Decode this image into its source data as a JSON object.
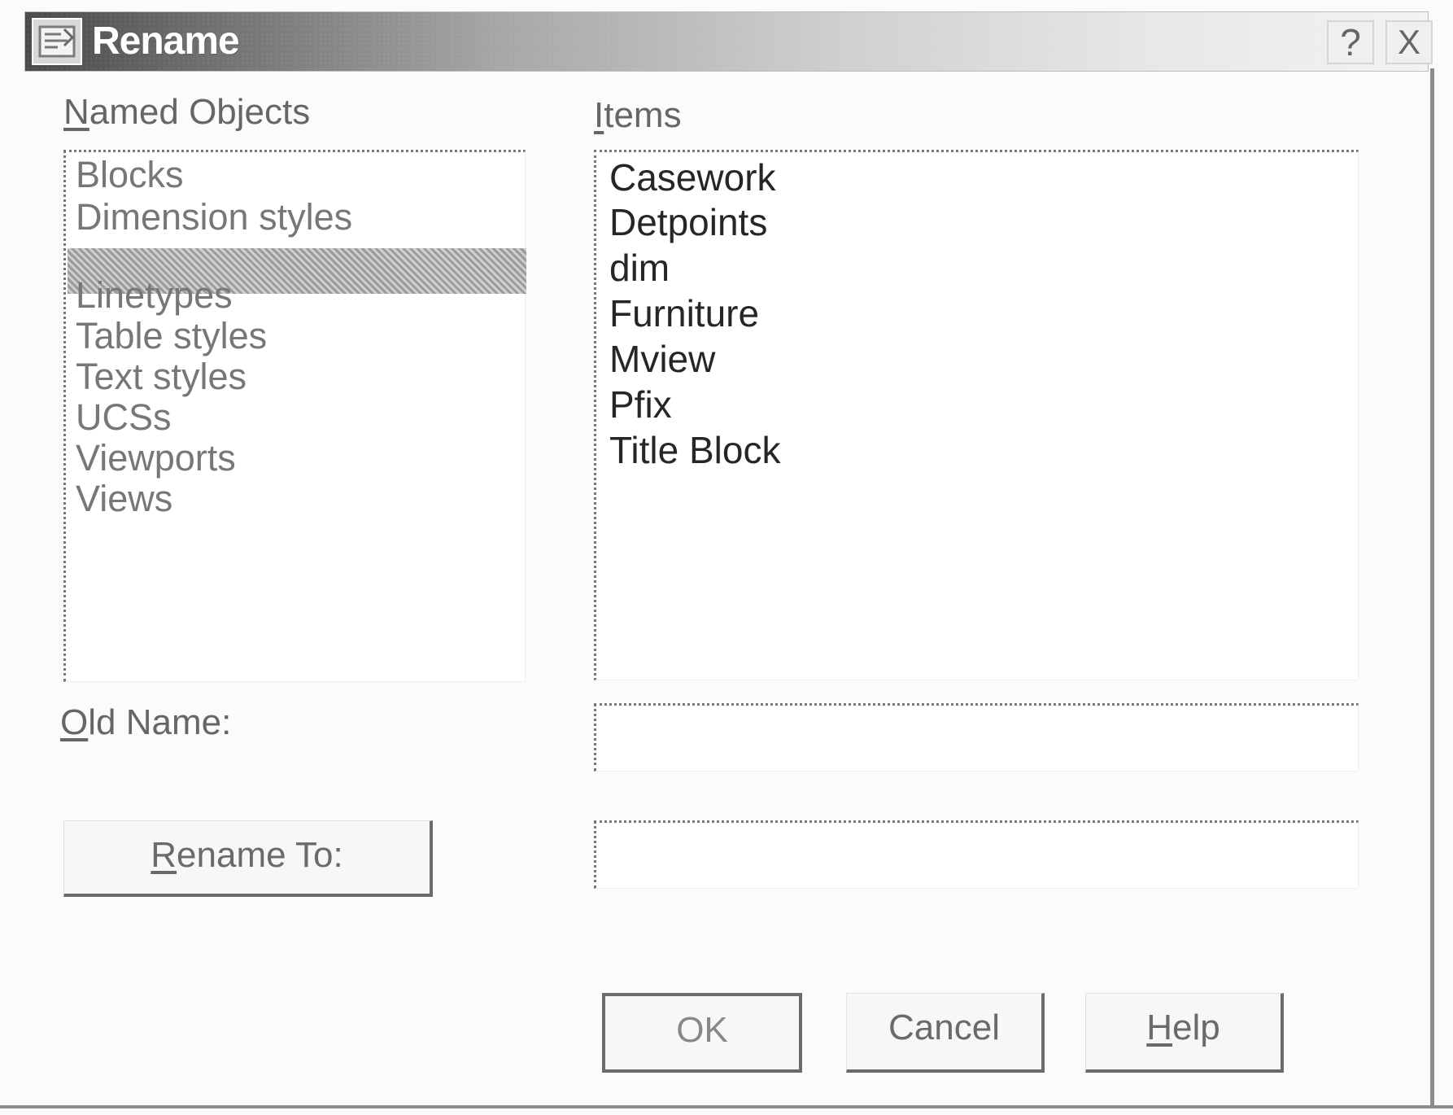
{
  "window": {
    "title": "Rename",
    "help_button": "?",
    "close_button": "X",
    "icon": "dialog-app-icon"
  },
  "named_objects": {
    "label_first": "N",
    "label_rest": "amed Objects",
    "selected_index": 2,
    "items": [
      "Blocks",
      "Dimension styles",
      "",
      "Linetypes",
      "Table styles",
      "Text styles",
      "UCSs",
      "Viewports",
      "Views"
    ]
  },
  "items": {
    "label_first": "I",
    "label_rest": "tems",
    "entries": [
      "Casework",
      "Detpoints",
      "dim",
      "Furniture",
      "Mview",
      "Pfix",
      "Title Block"
    ]
  },
  "fields": {
    "old_name_first": "O",
    "old_name_rest": "ld Name:",
    "old_name_value": "",
    "rename_to_value": ""
  },
  "buttons": {
    "rename_first": "R",
    "rename_rest": "ename To:",
    "ok": "OK",
    "cancel": "Cancel",
    "help_first": "H",
    "help_rest": "elp"
  },
  "colors": {
    "titlebar_dark": "#4a4a4a",
    "titlebar_light": "#f3f3f3",
    "text_disabled": "#777777",
    "text_enabled": "#262626"
  }
}
